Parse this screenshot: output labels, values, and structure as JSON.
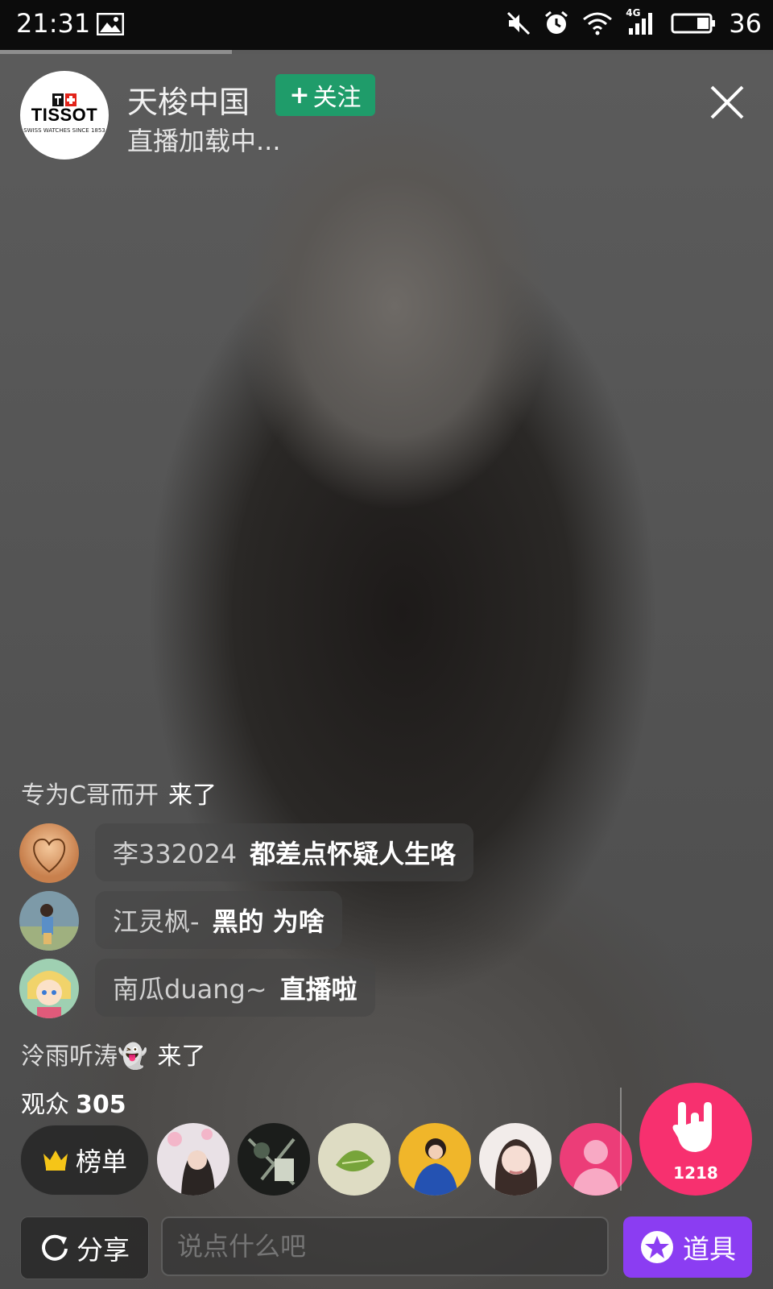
{
  "status_bar": {
    "time": "21:31",
    "network": "4G",
    "battery": "36",
    "icons": [
      "image-icon",
      "mute-icon",
      "alarm-icon",
      "wifi-icon",
      "signal-icon",
      "battery-icon"
    ]
  },
  "loading_progress": 0.3,
  "host": {
    "avatar_brand": "TISSOT",
    "avatar_tagline": "SWISS WATCHES SINCE 1853",
    "name": "天梭中国",
    "follow_label": "关注",
    "status": "直播加载中..."
  },
  "chat": {
    "notices": [
      {
        "user": "专为C哥而开",
        "text": "来了"
      },
      {
        "user": "泠雨听涛👻",
        "text": "来了"
      }
    ],
    "messages": [
      {
        "user": "李332024",
        "text": "都差点怀疑人生咯"
      },
      {
        "user": "江灵枫-",
        "text": "黑的 为啥"
      },
      {
        "user": "南瓜duang~",
        "text": "直播啦"
      }
    ]
  },
  "viewers": {
    "label": "观众",
    "count": "305"
  },
  "ranking": {
    "label": "榜单"
  },
  "likes": {
    "count": "1218"
  },
  "bottom": {
    "share_label": "分享",
    "input_placeholder": "说点什么吧",
    "props_label": "道具"
  },
  "colors": {
    "follow": "#1f9c6a",
    "like": "#f7306f",
    "props": "#8b3df2",
    "status_bar": "#0c0c0c"
  }
}
